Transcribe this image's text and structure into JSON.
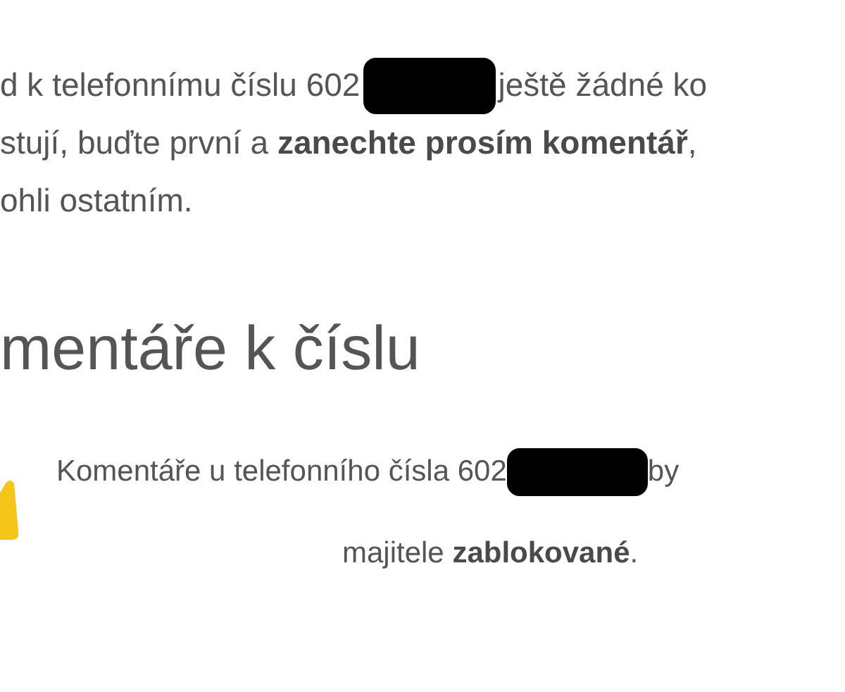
{
  "intro": {
    "lines": [
      [
        {
          "kind": "text",
          "text": "d k telefonnímu číslu 602"
        },
        {
          "kind": "redaction"
        },
        {
          "kind": "text",
          "text": " ještě žádné ko"
        }
      ],
      [
        {
          "kind": "text",
          "text": "stují, buďte první a **zanechte prosím komentář**,"
        }
      ],
      [
        {
          "kind": "text",
          "text": "ohli ostatním."
        }
      ]
    ]
  },
  "heading": "mentáře k číslu",
  "notice": {
    "kind": "warning",
    "lines": [
      [
        {
          "kind": "text",
          "text": "Komentáře u telefonního čísla 602"
        },
        {
          "kind": "redaction"
        },
        {
          "kind": "text",
          "text": "by"
        }
      ],
      [
        {
          "kind": "text",
          "text": "majitele **zablokované**."
        }
      ]
    ]
  }
}
